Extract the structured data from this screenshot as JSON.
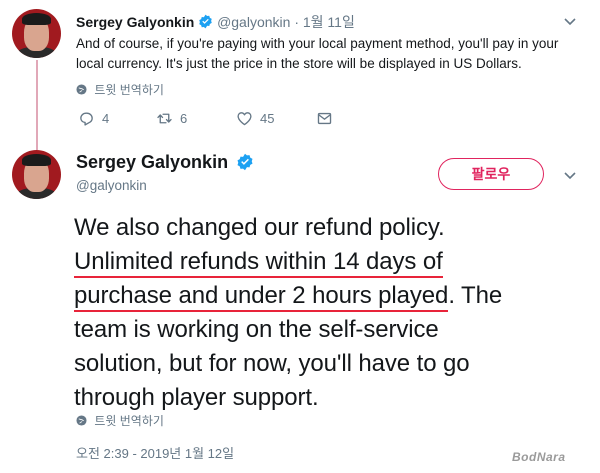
{
  "colors": {
    "accent": "#e0245e",
    "verified": "#1da1f2",
    "muted": "#657786",
    "highlight": "#e8243a"
  },
  "tweet1": {
    "name": "Sergey Galyonkin",
    "handle": "@galyonkin",
    "date": "· 1월 11일",
    "text": "And of course, if you're paying with your local payment method, you'll pay in your local currency. It's just the price in the store will be displayed in US Dollars.",
    "translate": "트윗 번역하기",
    "replies": "4",
    "retweets": "6",
    "likes": "45"
  },
  "tweet2": {
    "name": "Sergey Galyonkin",
    "handle": "@galyonkin",
    "follow_label": "팔로우",
    "text_lines": [
      "We also changed our refund policy.",
      "Unlimited refunds within 14 days of",
      "purchase and under 2 hours played",
      ". The",
      "team is working on the self-service",
      "solution, but for now, you'll have to go",
      "through player support."
    ],
    "translate": "트윗 번역하기",
    "timestamp": "오전 2:39 - 2019년 1월 12일"
  },
  "watermark": "BodNara"
}
